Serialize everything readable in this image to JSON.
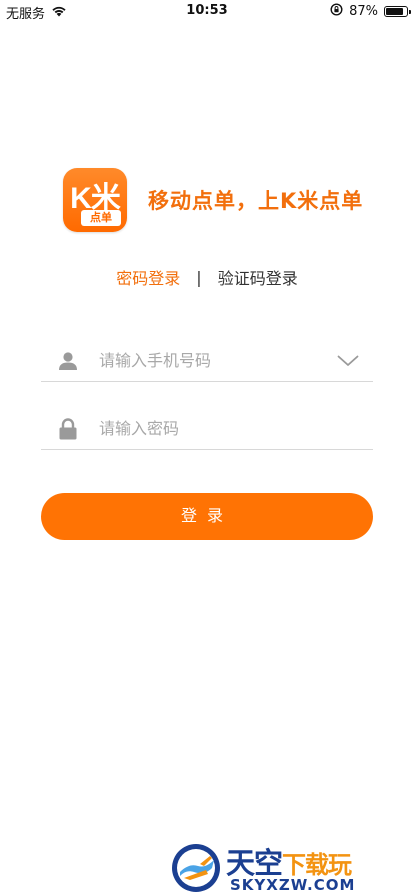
{
  "status_bar": {
    "carrier": "无服务",
    "time": "10:53",
    "battery_percent": "87%",
    "battery_level": 0.87
  },
  "brand": {
    "icon_text": "K米",
    "icon_sub": "点单",
    "slogan": "移动点单，上K米点单",
    "accent_color": "#f26f0d",
    "button_color": "#ff7304"
  },
  "tabs": {
    "password_login": "密码登录",
    "separator": "|",
    "code_login": "验证码登录"
  },
  "form": {
    "phone_placeholder": "请输入手机号码",
    "password_placeholder": "请输入密码",
    "login_label": "登录"
  },
  "watermark": {
    "title_main": "天空",
    "title_sub": "下载玩",
    "url": "SKYXZW.COM"
  },
  "icons": {
    "wifi": "wifi-icon",
    "lock_rotation": "orientation-lock-icon",
    "user": "user-icon",
    "lock": "lock-icon",
    "dropdown": "chevron-down-icon"
  }
}
